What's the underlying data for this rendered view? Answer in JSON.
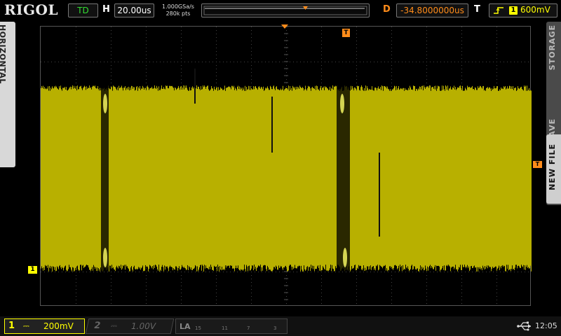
{
  "topbar": {
    "brand": "RIGOL",
    "run_status": "TD",
    "horizontal_label": "H",
    "timebase": "20.00us",
    "sample_rate": "1.000GSa/s",
    "memory_depth": "280k pts",
    "delay_label": "D",
    "delay_value": "-34.8000000us",
    "trigger_label": "T",
    "trigger_channel": "1",
    "trigger_level": "600mV"
  },
  "side": {
    "left_tab": "HORIZONTAL",
    "right_storage": "STORAGE",
    "right_save": "SAVE",
    "new_file": "NEW FILE"
  },
  "markers": {
    "ch1": "1",
    "trigger": "T"
  },
  "channels": {
    "ch1": {
      "number": "1",
      "coupling": "⎓",
      "scale": "200mV",
      "color": "#ffff00"
    },
    "ch2": {
      "number": "2",
      "coupling": "⎓",
      "scale": "1.00V"
    }
  },
  "la": {
    "label": "LA",
    "bits": [
      "15",
      "11",
      "7",
      "3"
    ]
  },
  "status": {
    "time": "12:05"
  },
  "colors": {
    "accent": "#ff8c1a",
    "trace": "#b8b000",
    "grid": "#3c3c3c"
  }
}
